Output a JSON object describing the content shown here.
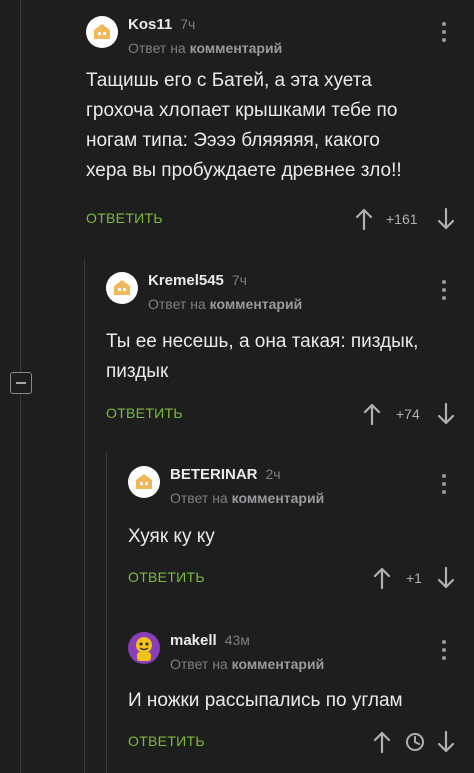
{
  "comments": [
    {
      "username": "Kos11",
      "time": "7ч",
      "reply_prefix": "Ответ на",
      "reply_target": "комментарий",
      "text_lines": [
        "Тащишь его с Батей, а эта хуета",
        "грохоча хлопает крышками тебе по",
        "ногам типа: Ээээ бляяяяя, какого",
        "хера вы пробуждаете древнее зло!!"
      ],
      "reply_button": "ОТВЕТИТЬ",
      "rating": "+161"
    },
    {
      "username": "Kremel545",
      "time": "7ч",
      "reply_prefix": "Ответ на",
      "reply_target": "комментарий",
      "text_lines": [
        "Ты ее несешь, а она такая: пиздык,",
        "пиздык"
      ],
      "reply_button": "ОТВЕТИТЬ",
      "rating": "+74"
    },
    {
      "username": "BETERINAR",
      "time": "2ч",
      "reply_prefix": "Ответ на",
      "reply_target": "комментарий",
      "text_lines": [
        "Хуяк ку ку"
      ],
      "reply_button": "ОТВЕТИТЬ",
      "rating": "+1"
    },
    {
      "username": "makell",
      "time": "43м",
      "reply_prefix": "Ответ на",
      "reply_target": "комментарий",
      "text_lines": [
        "И ножки рассыпались по углам"
      ],
      "reply_button": "ОТВЕТИТЬ",
      "rating_hidden_icon": "clock-icon"
    }
  ],
  "colors": {
    "background": "#1e1e1f",
    "text": "#eaeaeb",
    "muted": "#7e7e82",
    "accent_green": "#7dbb3a",
    "thread_line": "#3a3a3c"
  },
  "icons": [
    "avatar-default-icon",
    "avatar-user-icon",
    "more-vertical-icon",
    "arrow-up-icon",
    "arrow-down-icon",
    "clock-icon",
    "collapse-thread-icon"
  ]
}
